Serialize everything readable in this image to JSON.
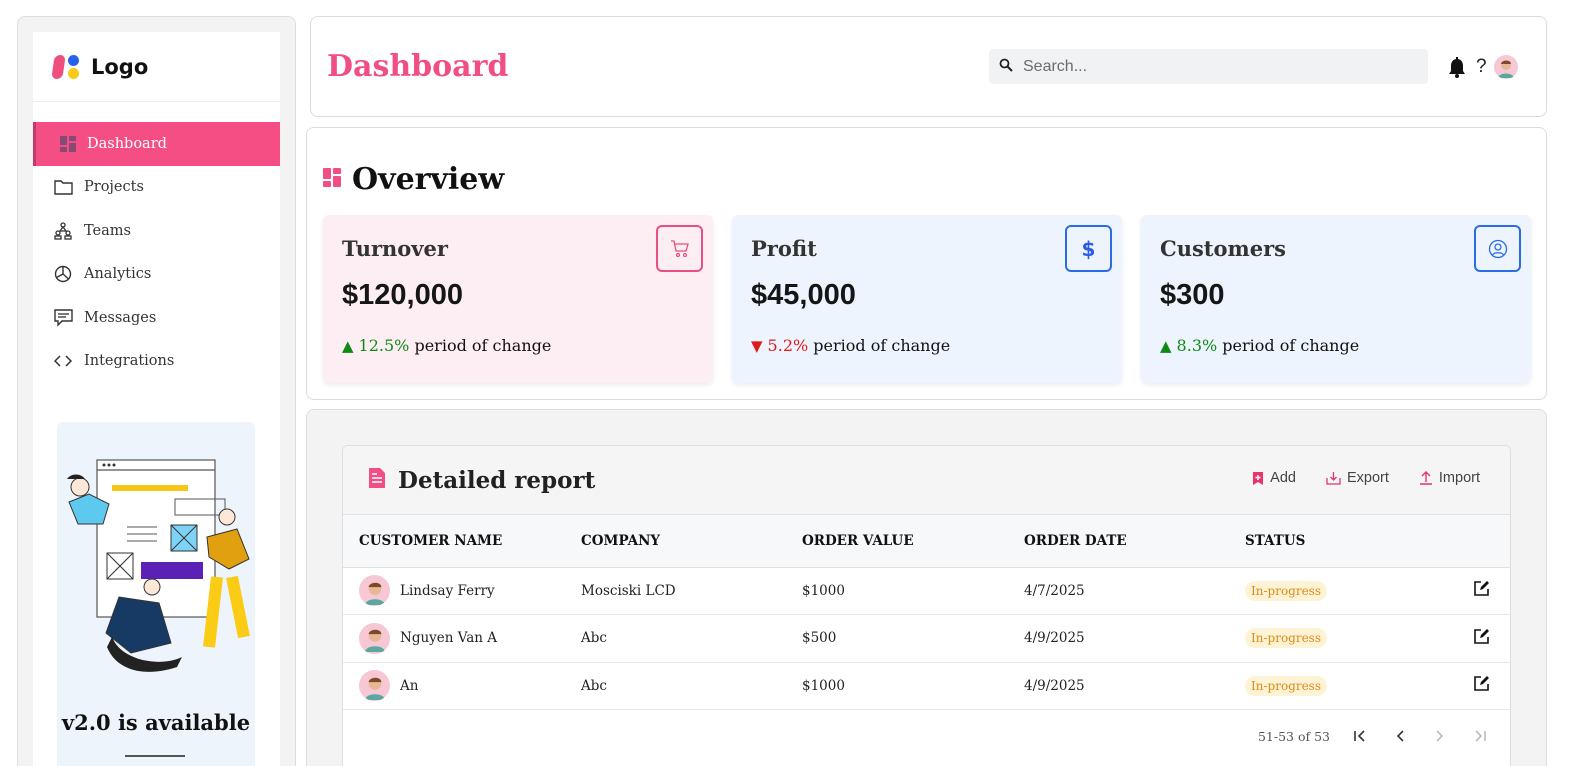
{
  "sidebar": {
    "logo_text": "Logo",
    "items": [
      {
        "label": "Dashboard",
        "icon": "dashboard-icon",
        "active": true
      },
      {
        "label": "Projects",
        "icon": "folder-icon"
      },
      {
        "label": "Teams",
        "icon": "teams-icon"
      },
      {
        "label": "Analytics",
        "icon": "pie-chart-icon"
      },
      {
        "label": "Messages",
        "icon": "message-icon"
      },
      {
        "label": "Integrations",
        "icon": "code-icon"
      }
    ],
    "promo_title": "v2.0 is available"
  },
  "header": {
    "title": "Dashboard",
    "search_placeholder": "Search...",
    "help_label": "?"
  },
  "overview": {
    "title": "Overview",
    "cards": [
      {
        "title": "Turnover",
        "value": "$120,000",
        "arrow": "▲",
        "change": "12.5%",
        "change_text": " period of change",
        "trend": "up",
        "icon": "cart-icon"
      },
      {
        "title": "Profit",
        "value": "$45,000",
        "arrow": "▼",
        "change": "5.2%",
        "change_text": " period of change",
        "trend": "down",
        "icon": "dollar-icon",
        "icon_glyph": "$"
      },
      {
        "title": "Customers",
        "value": "$300",
        "arrow": "▲",
        "change": "8.3%",
        "change_text": " period of change",
        "trend": "up",
        "icon": "user-circle-icon"
      }
    ]
  },
  "report": {
    "title": "Detailed report",
    "actions": {
      "add": "Add",
      "export": "Export",
      "import": "Import"
    },
    "columns": [
      "CUSTOMER NAME",
      "COMPANY",
      "ORDER VALUE",
      "ORDER DATE",
      "STATUS"
    ],
    "rows": [
      {
        "name": "Lindsay Ferry",
        "company": "Mosciski LCD",
        "value": "$1000",
        "date": "4/7/2025",
        "status": "In-progress"
      },
      {
        "name": "Nguyen Van A",
        "company": "Abc",
        "value": "$500",
        "date": "4/9/2025",
        "status": "In-progress"
      },
      {
        "name": "An",
        "company": "Abc",
        "value": "$1000",
        "date": "4/9/2025",
        "status": "In-progress"
      }
    ],
    "pagination": "51-53 of 53"
  },
  "colors": {
    "accent": "#f04e85",
    "blue": "#2c6be8",
    "up": "#0f8a17",
    "down": "#e11919",
    "badge": "#e08a14"
  }
}
